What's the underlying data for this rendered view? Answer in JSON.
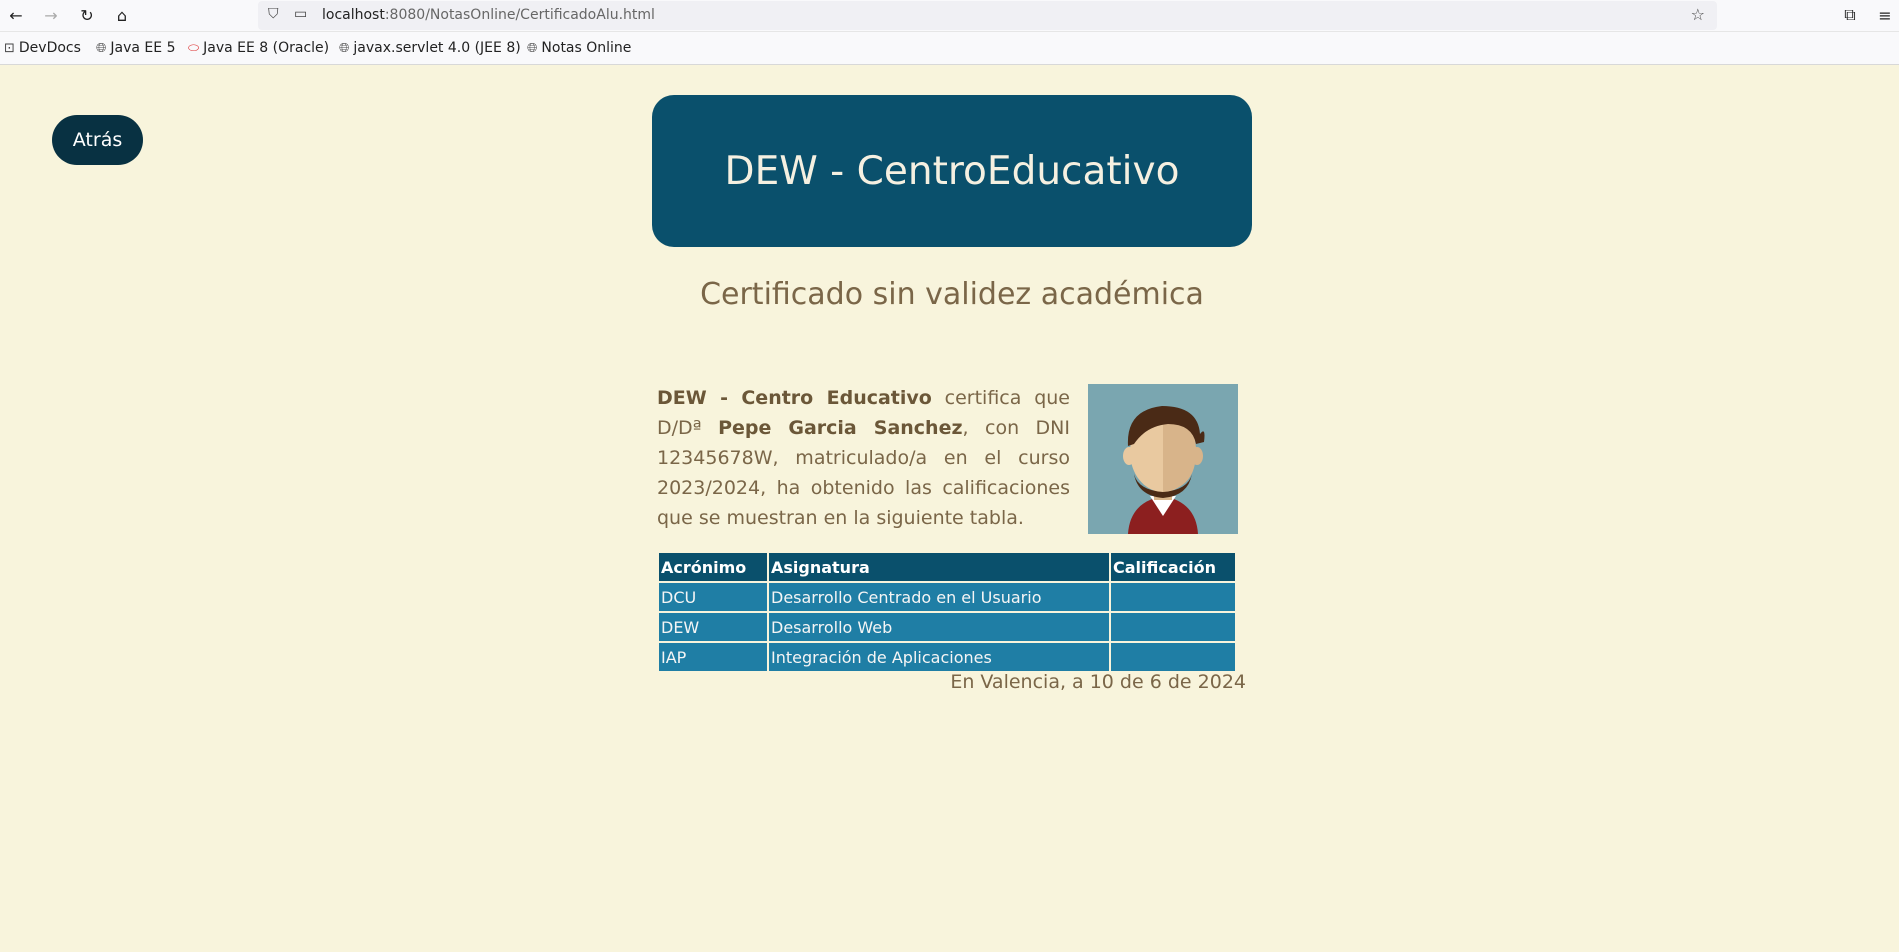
{
  "browser": {
    "url_host": "localhost",
    "url_rest": ":8080/NotasOnline/CertificadoAlu.html",
    "bookmarks": [
      "DevDocs",
      "Java EE 5",
      "Java EE 8 (Oracle)",
      "javax.servlet 4.0 (JEE 8)",
      "Notas Online"
    ]
  },
  "page": {
    "back_label": "Atrás",
    "header_title": "DEW - CentroEducativo",
    "subtitle": "Certificado sin validez académica",
    "cert": {
      "org": "DEW - Centro Educativo",
      "text1": " certifica que D/Dª ",
      "student": "Pepe Garcia Sanchez",
      "text2": ", con DNI 12345678W, matriculado/a en el curso 2023/2024, ha obtenido las calificaciones que se muestran en la siguiente tabla."
    },
    "table": {
      "headers": [
        "Acrónimo",
        "Asignatura",
        "Calificación"
      ],
      "rows": [
        [
          "DCU",
          "Desarrollo Centrado en el Usuario",
          ""
        ],
        [
          "DEW",
          "Desarrollo Web",
          ""
        ],
        [
          "IAP",
          "Integración de Aplicaciones",
          ""
        ]
      ]
    },
    "date_line": "En Valencia, a 10 de 6 de 2024"
  }
}
